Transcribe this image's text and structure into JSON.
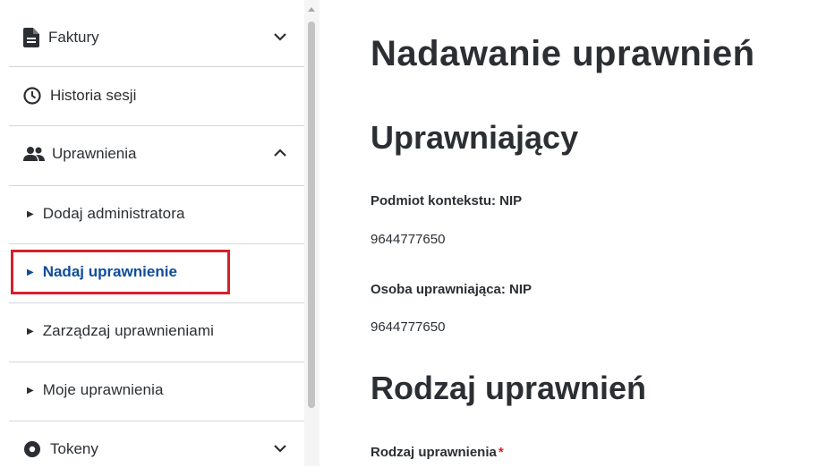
{
  "sidebar": {
    "items": [
      {
        "label": "Faktury",
        "icon": "document-icon",
        "chevron": "down"
      },
      {
        "label": "Historia sesji",
        "icon": "clock-icon"
      },
      {
        "label": "Uprawnienia",
        "icon": "users-icon",
        "chevron": "up"
      },
      {
        "label": "Dodaj administratora"
      },
      {
        "label": "Nadaj uprawnienie",
        "active": true
      },
      {
        "label": "Zarządzaj uprawnieniami"
      },
      {
        "label": "Moje uprawnienia"
      },
      {
        "label": "Tokeny",
        "icon": "token-icon",
        "chevron": "down"
      }
    ]
  },
  "main": {
    "title": "Nadawanie uprawnień",
    "section1": "Uprawniający",
    "context_label": "Podmiot kontekstu: NIP",
    "context_value": "9644777650",
    "person_label": "Osoba uprawniająca: NIP",
    "person_value": "9644777650",
    "section2": "Rodzaj uprawnień",
    "type_label": "Rodzaj uprawnienia",
    "required_mark": "*"
  },
  "colors": {
    "active_text": "#0f4d9a",
    "highlight_border": "#d6202b",
    "divider": "#d3d6da"
  }
}
